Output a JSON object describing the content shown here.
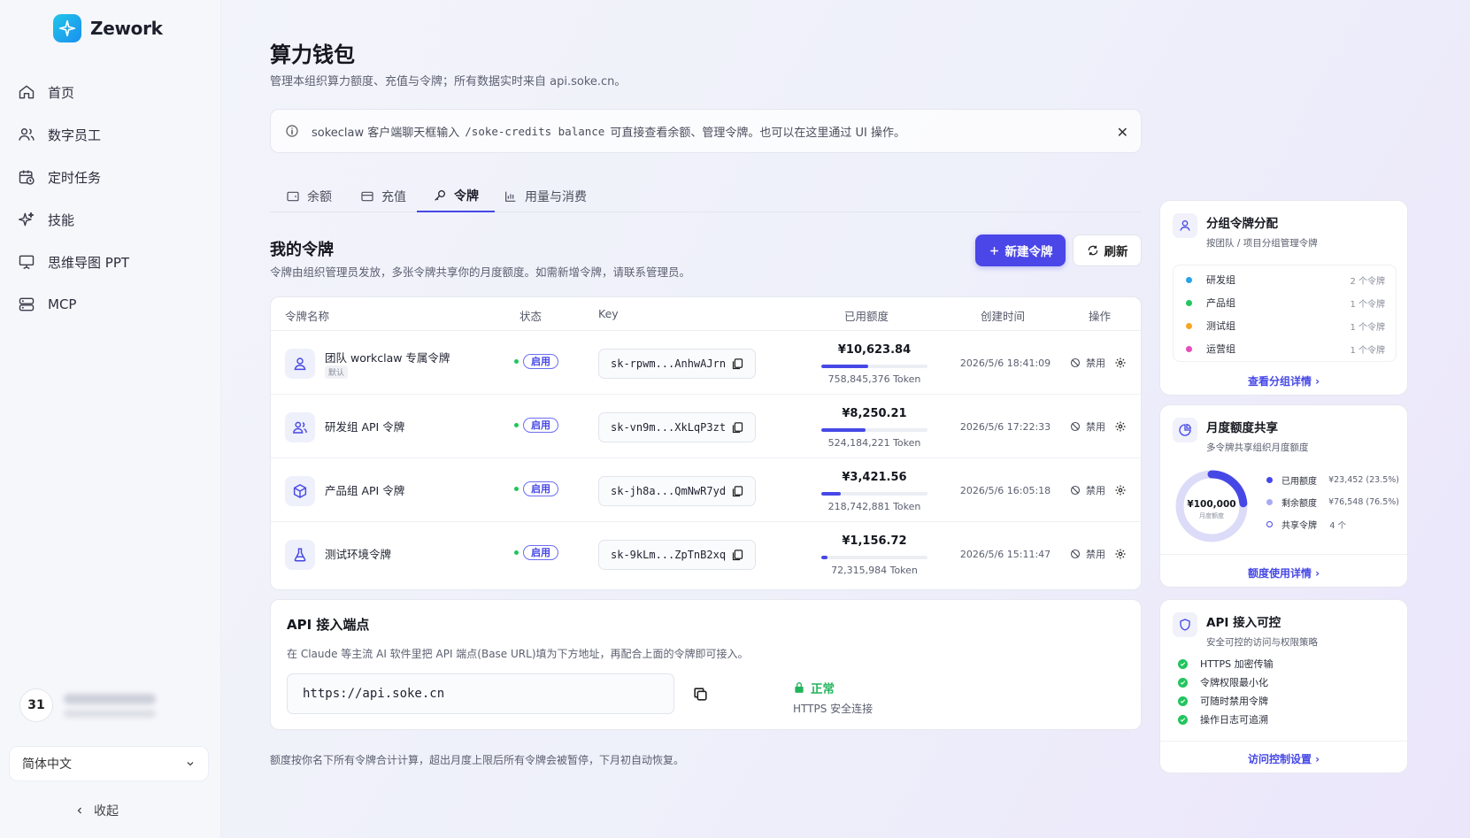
{
  "app": {
    "name": "Zework"
  },
  "sidebar": {
    "nav": [
      {
        "label": "首页",
        "icon": "home-icon"
      },
      {
        "label": "数字员工",
        "icon": "users-icon"
      },
      {
        "label": "定时任务",
        "icon": "calendar-clock-icon"
      },
      {
        "label": "技能",
        "icon": "sparkles-icon"
      },
      {
        "label": "思维导图 PPT",
        "icon": "presentation-icon"
      },
      {
        "label": "MCP",
        "icon": "server-icon"
      }
    ],
    "user": {
      "avatar_text": "31"
    },
    "language": "简体中文",
    "collapse_label": "收起"
  },
  "page": {
    "title": "算力钱包",
    "subtitle": "管理本组织算力额度、充值与令牌；所有数据实时来自 api.soke.cn。"
  },
  "notice": {
    "text_before": "sokeclaw 客户端聊天框输入",
    "command": "/soke-credits balance",
    "text_after": "可直接查看余额、管理令牌。也可以在这里通过 UI 操作。",
    "close": "✕"
  },
  "tabs": [
    {
      "label": "余额",
      "icon": "wallet-icon"
    },
    {
      "label": "充值",
      "icon": "card-icon"
    },
    {
      "label": "令牌",
      "icon": "key-icon",
      "active": true
    },
    {
      "label": "用量与消费",
      "icon": "bar-chart-icon"
    }
  ],
  "tokens_section": {
    "title": "我的令牌",
    "subtitle": "令牌由组织管理员发放，多张令牌共享你的月度额度。如需新增令牌，请联系管理员。",
    "new_button": "新建令牌",
    "refresh_button": "刷新",
    "columns": {
      "name": "令牌名称",
      "status": "状态",
      "key": "Key",
      "used": "已用额度",
      "created": "创建时间",
      "actions": "操作"
    },
    "rows": [
      {
        "icon": "user-icon",
        "name": "团队 workclaw 专属令牌",
        "tag": "默认",
        "status": "启用",
        "key": "sk-rpwm...AnhwAJrn",
        "amount": "¥10,623.84",
        "usage": 0.44,
        "tokens": "758,845,376 Token",
        "created": "2026/5/6 18:41:09",
        "disable": "禁用"
      },
      {
        "icon": "team-icon",
        "name": "研发组 API 令牌",
        "tag": "",
        "status": "启用",
        "key": "sk-vn9m...XkLqP3zt",
        "amount": "¥8,250.21",
        "usage": 0.42,
        "tokens": "524,184,221 Token",
        "created": "2026/5/6 17:22:33",
        "disable": "禁用"
      },
      {
        "icon": "box-icon",
        "name": "产品组 API 令牌",
        "tag": "",
        "status": "启用",
        "key": "sk-jh8a...QmNwR7yd",
        "amount": "¥3,421.56",
        "usage": 0.18,
        "tokens": "218,742,881 Token",
        "created": "2026/5/6 16:05:18",
        "disable": "禁用"
      },
      {
        "icon": "flask-icon",
        "name": "测试环境令牌",
        "tag": "",
        "status": "启用",
        "key": "sk-9kLm...ZpTnB2xq",
        "amount": "¥1,156.72",
        "usage": 0.06,
        "tokens": "72,315,984 Token",
        "created": "2026/5/6 15:11:47",
        "disable": "禁用"
      }
    ]
  },
  "api": {
    "title": "API 接入端点",
    "subtitle": "在 Claude 等主流 AI 软件里把 API 端点(Base URL)填为下方地址，再配合上面的令牌即可接入。",
    "url": "https://api.soke.cn",
    "status": "正常",
    "status_sub": "HTTPS 安全连接"
  },
  "footnote": "额度按你名下所有令牌合计计算，超出月度上限后所有令牌会被暂停，下月初自动恢复。",
  "groups_card": {
    "title": "分组令牌分配",
    "subtitle": "按团队 / 项目分组管理令牌",
    "groups": [
      {
        "name": "研发组",
        "count": "2 个令牌",
        "color": "#2aa3e8"
      },
      {
        "name": "产品组",
        "count": "1 个令牌",
        "color": "#22c55e"
      },
      {
        "name": "测试组",
        "count": "1 个令牌",
        "color": "#f5a524"
      },
      {
        "name": "运营组",
        "count": "1 个令牌",
        "color": "#e84cbd"
      }
    ],
    "link": "查看分组详情 ›"
  },
  "quota_card": {
    "title": "月度额度共享",
    "subtitle": "多令牌共享组织月度额度",
    "total": "¥100,000",
    "total_label": "月度额度",
    "used_fraction": 0.235,
    "legend": [
      {
        "label": "已用额度",
        "value": "¥23,452 (23.5%)",
        "color": "#4648e6"
      },
      {
        "label": "剩余额度",
        "value": "¥76,548 (76.5%)",
        "color": "#a9aaf6"
      },
      {
        "label": "共享令牌",
        "value": "4 个",
        "color": "#4648e6"
      }
    ],
    "link": "额度使用详情 ›"
  },
  "access_card": {
    "title": "API 接入可控",
    "subtitle": "安全可控的访问与权限策略",
    "items": [
      "HTTPS 加密传输",
      "令牌权限最小化",
      "可随时禁用令牌",
      "操作日志可追溯"
    ],
    "link": "访问控制设置 ›"
  }
}
